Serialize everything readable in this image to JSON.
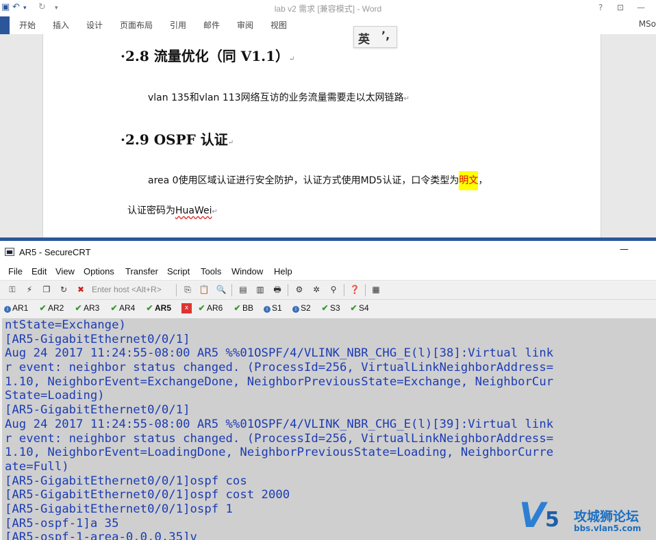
{
  "word": {
    "title": "lab v2 需求 [兼容模式] - Word",
    "title_controls": [
      "?",
      "⊡",
      "—"
    ],
    "menu": [
      "开始",
      "插入",
      "设计",
      "页面布局",
      "引用",
      "邮件",
      "审阅",
      "视图"
    ],
    "account": "MSo",
    "ime": {
      "lang": "英",
      "punct": "’,"
    },
    "doc": {
      "h1": "2.8  流量优化（同 V1.1）",
      "p1": "vlan 135和vlan 113网络互访的业务流量需要走以太网链路",
      "h2": "2.9 OSPF 认证",
      "p2_pre": "area 0使用区域认证进行安全防护，认证方式使用MD5认证，口令类型为",
      "p2_hl": "明文",
      "p2_post": "，",
      "p3_pre": "认证密码为",
      "p3_link": "HuaWei",
      "para_mark": "↵"
    }
  },
  "crt": {
    "title": "AR5 - SecureCRT",
    "minimize": "—",
    "menu": [
      "File",
      "Edit",
      "View",
      "Options",
      "Transfer",
      "Script",
      "Tools",
      "Window",
      "Help"
    ],
    "enter_host": "Enter host <Alt+R>",
    "tabs": [
      {
        "label": "AR1",
        "status": "info"
      },
      {
        "label": "AR2",
        "status": "ok"
      },
      {
        "label": "AR3",
        "status": "ok"
      },
      {
        "label": "AR4",
        "status": "ok"
      },
      {
        "label": "AR5",
        "status": "ok"
      },
      {
        "label": "AR6",
        "status": "ok"
      },
      {
        "label": "BB",
        "status": "ok"
      },
      {
        "label": "S1",
        "status": "info"
      },
      {
        "label": "S2",
        "status": "info"
      },
      {
        "label": "S3",
        "status": "ok"
      },
      {
        "label": "S4",
        "status": "ok"
      }
    ],
    "tab_close": "x",
    "terminal": [
      "ntState=Exchange)",
      "[AR5-GigabitEthernet0/0/1]",
      "Aug 24 2017 11:24:55-08:00 AR5 %%01OSPF/4/VLINK_NBR_CHG_E(l)[38]:Virtual link",
      "r event: neighbor status changed. (ProcessId=256, VirtualLinkNeighborAddress=",
      "1.10, NeighborEvent=ExchangeDone, NeighborPreviousState=Exchange, NeighborCur",
      "State=Loading)",
      "[AR5-GigabitEthernet0/0/1]",
      "Aug 24 2017 11:24:55-08:00 AR5 %%01OSPF/4/VLINK_NBR_CHG_E(l)[39]:Virtual link",
      "r event: neighbor status changed. (ProcessId=256, VirtualLinkNeighborAddress=",
      "1.10, NeighborEvent=LoadingDone, NeighborPreviousState=Loading, NeighborCurre",
      "ate=Full)",
      "[AR5-GigabitEthernet0/0/1]ospf cos",
      "[AR5-GigabitEthernet0/0/1]ospf cost 2000",
      "[AR5-GigabitEthernet0/0/1]ospf 1",
      "[AR5-ospf-1]a 35",
      "[AR5-ospf-1-area-0.0.0.35]v"
    ]
  },
  "watermark": {
    "logo": "V",
    "logo_num": "5",
    "name": "攻城狮论坛",
    "url": "bbs.vlan5.com"
  },
  "colors": {
    "word_blue": "#2b579a",
    "terminal_text": "#1c3cb4",
    "terminal_bg": "#cfcfcf",
    "highlight": "#ffff00"
  }
}
